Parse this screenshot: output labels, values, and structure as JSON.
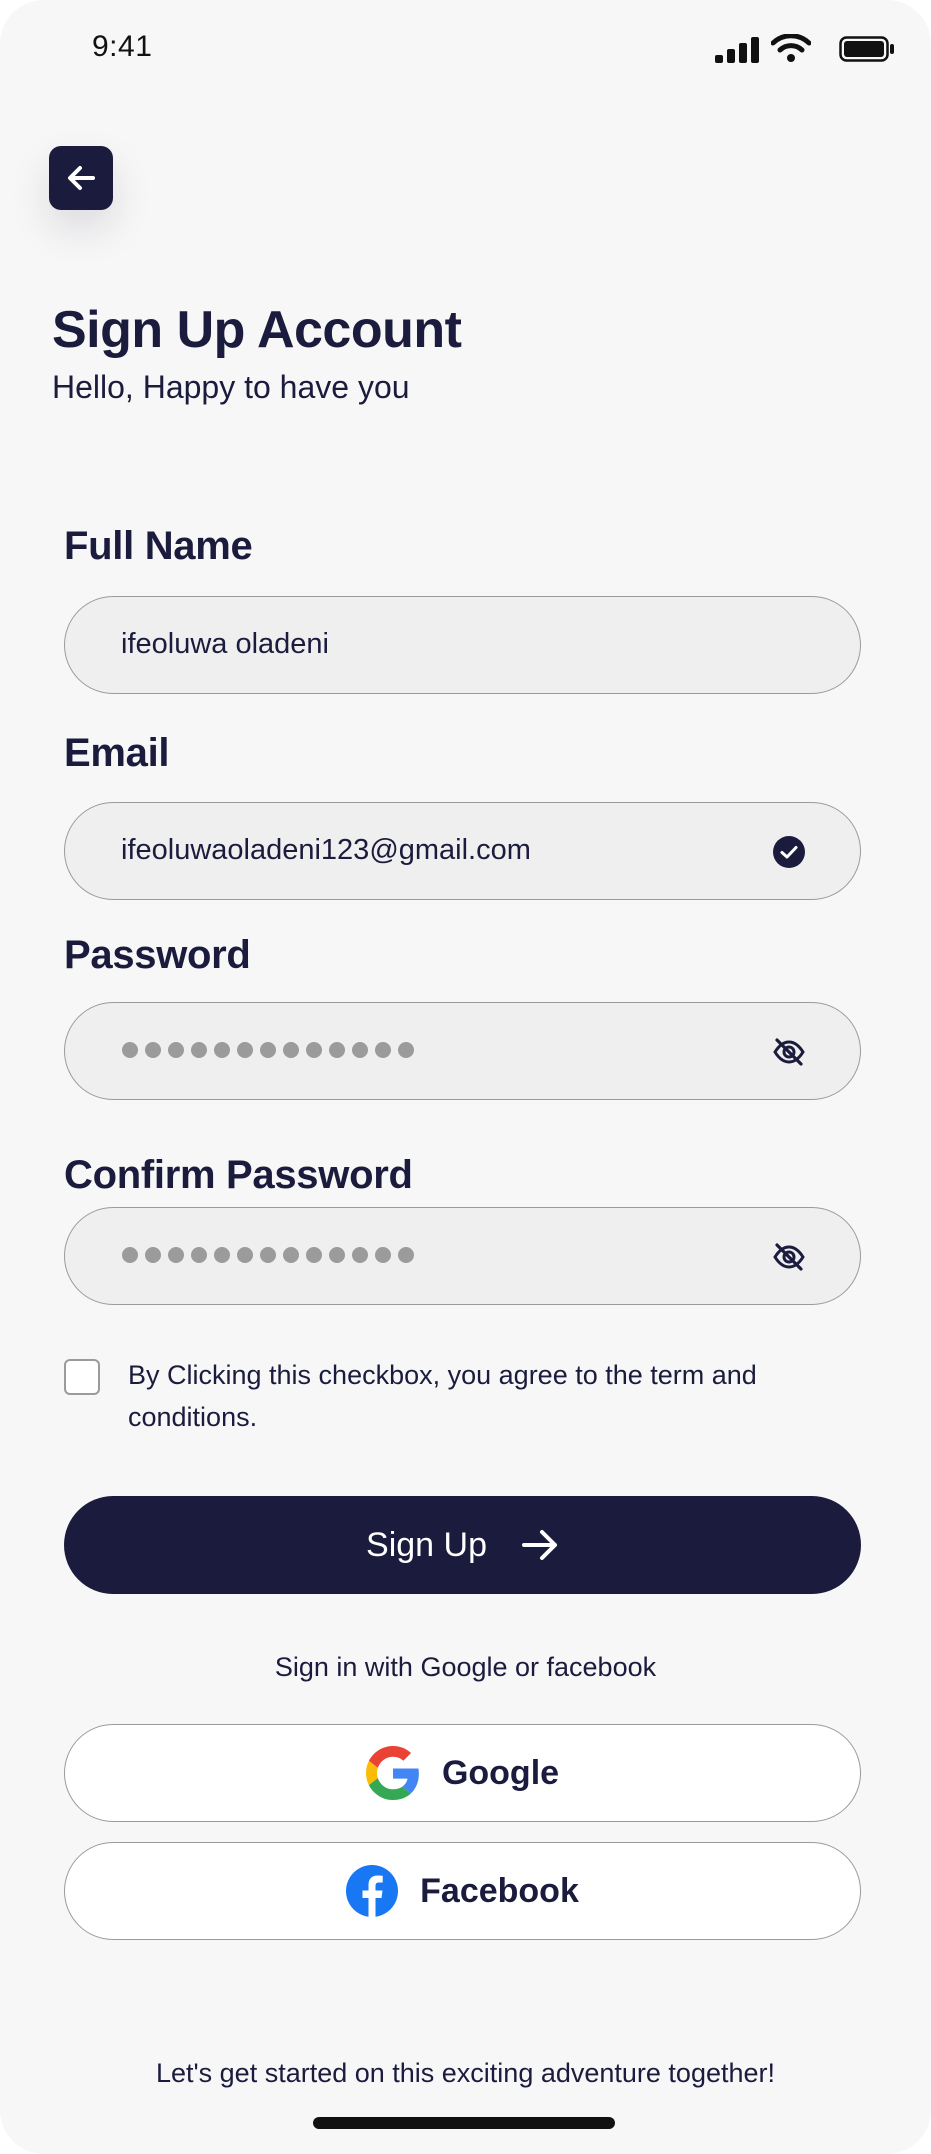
{
  "status_bar": {
    "time": "9:41"
  },
  "header": {
    "title": "Sign Up Account",
    "subtitle": "Hello, Happy to have you"
  },
  "form": {
    "full_name": {
      "label": "Full Name",
      "value": "ifeoluwa oladeni"
    },
    "email": {
      "label": "Email",
      "value": "ifeoluwaoladeni123@gmail.com",
      "status_icon": "check-circle-icon"
    },
    "password": {
      "label": "Password",
      "masked": true,
      "mask_count": 13,
      "toggle_icon": "eye-off-icon"
    },
    "confirm_password": {
      "label": "Confirm Password",
      "masked": true,
      "mask_count": 13,
      "toggle_icon": "eye-off-icon"
    },
    "terms": {
      "checked": false,
      "text": "By Clicking this checkbox, you agree to the term and conditions."
    }
  },
  "actions": {
    "sign_up_label": "Sign Up",
    "alt_text": "Sign in with Google or facebook",
    "google_label": "Google",
    "facebook_label": "Facebook"
  },
  "footer": {
    "text": "Let's get started on this exciting adventure together!"
  },
  "colors": {
    "primary": "#1b1c3d",
    "background": "#f7f7f7",
    "field": "#efefef",
    "facebook": "#1877f2"
  }
}
